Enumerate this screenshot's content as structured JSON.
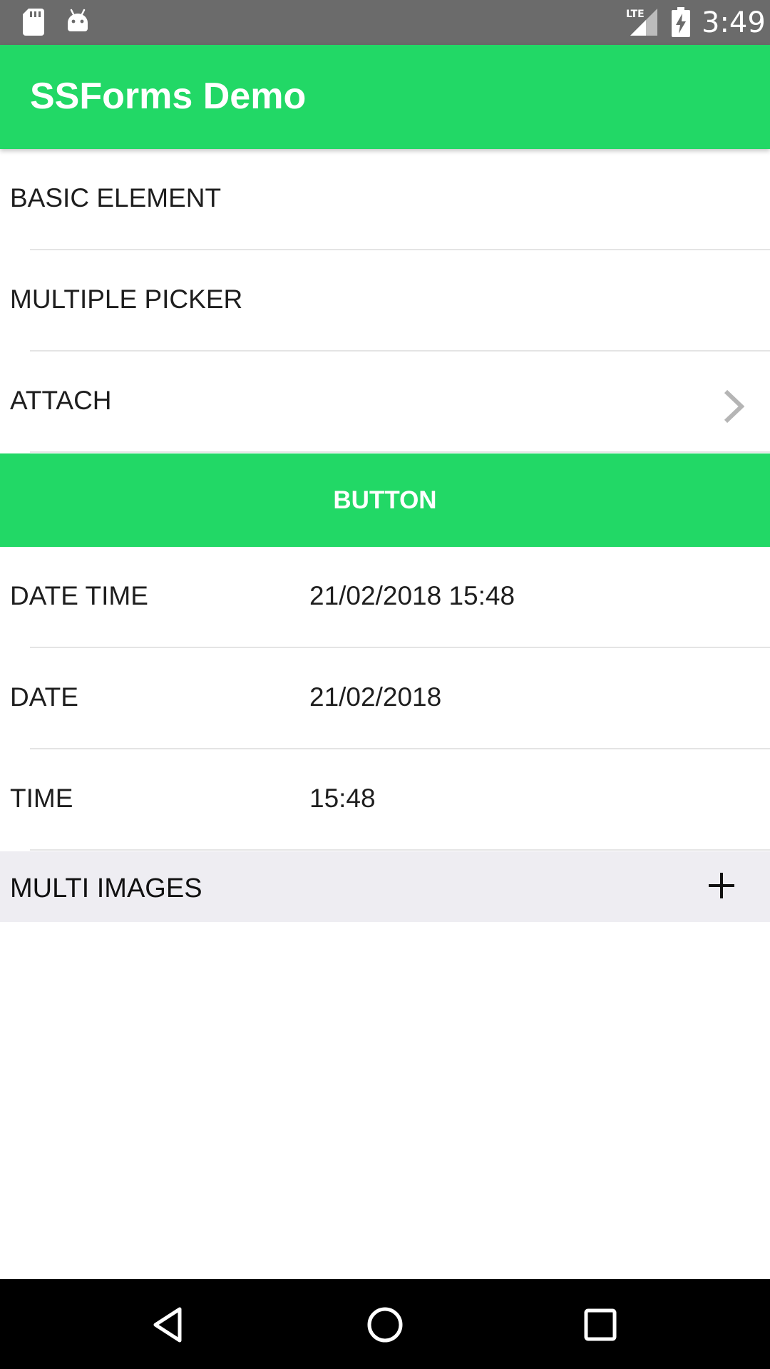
{
  "status_bar": {
    "time": "3:49",
    "network_label": "LTE",
    "icons": [
      "sd-card-icon",
      "android-icon",
      "signal-icon",
      "battery-charging-icon"
    ]
  },
  "app_bar": {
    "title": "SSForms Demo"
  },
  "form": {
    "basic_element": {
      "label": "BASIC ELEMENT"
    },
    "multiple_picker": {
      "label": "MULTIPLE PICKER"
    },
    "attach": {
      "label": "ATTACH",
      "icon": "chevron-right-icon"
    },
    "button": {
      "label": "BUTTON"
    },
    "date_time": {
      "label": "DATE TIME",
      "value": "21/02/2018 15:48"
    },
    "date": {
      "label": "DATE",
      "value": "21/02/2018"
    },
    "time": {
      "label": "TIME",
      "value": "15:48"
    },
    "multi_images": {
      "label": "MULTI IMAGES",
      "icon": "plus-icon"
    }
  },
  "nav_bar": {
    "icons": [
      "back-icon",
      "home-icon",
      "recents-icon"
    ]
  },
  "colors": {
    "accent": "#22d866",
    "status_bar": "#6b6b6b",
    "section_bg": "#eeedf2"
  }
}
